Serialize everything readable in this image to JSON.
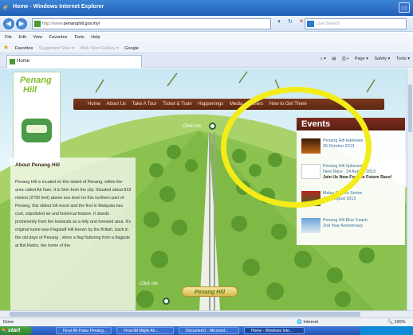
{
  "window": {
    "title": "Home - Windows Internet Explorer"
  },
  "address": {
    "url_prefix": "http://www.",
    "url_host": "penanghill.gov.my/",
    "search_placeholder": "Live Search"
  },
  "menu": [
    "File",
    "Edit",
    "View",
    "Favorites",
    "Tools",
    "Help"
  ],
  "favorites_bar": {
    "label": "Favorites",
    "items": [
      "Suggested Sites ▾",
      "Web Slice Gallery ▾",
      "Google"
    ]
  },
  "tab": {
    "label": "Home"
  },
  "command_bar": [
    "Page ▾",
    "Safety ▾",
    "Tools ▾"
  ],
  "site": {
    "logo_line1": "Penang",
    "logo_line2": "Hill",
    "nav": [
      "Home",
      "About Us",
      "Take A Tour",
      "Ticket & Train",
      "Happenings",
      "Media",
      "Others",
      "How to Get There"
    ],
    "click_me_top": "Click me",
    "click_me_bottom": "Click me",
    "banner": "Penang Hill",
    "about": {
      "title": "About Penang Hill",
      "body": "Penang Hill is located on this island of Penang, within the area called Air Itam. It is 5km from the city. Situated about 823 meters (2750 feet) above sea level on this northern part of Penang, this oldest hill resort and the first in Malaysia has cool, unpolluted air and historical feature. It stands prominently from the lowlands as a hilly and forested area. It's original name was Flagstaff Hill known by the British, back in the old days of Penang , when a flag fluttering from a flagpole at Bel Retiro, the home of the"
    },
    "events": {
      "heading": "Events",
      "items": [
        {
          "line1": "Penang Hill Hallowee",
          "line2": "26 October 2013",
          "line3": ""
        },
        {
          "line1": "Penang Hill Xplorace",
          "line2": "Next Race : 24 August 2013",
          "line3": "Join Us Now For The Future Race!"
        },
        {
          "line1": "Malay Culture Series",
          "line2": "17th August 2013",
          "line3": ""
        },
        {
          "line1": "Penang Hill Blue Coach",
          "line2": "2nd Year Anniversary",
          "line3": ""
        }
      ]
    }
  },
  "status": {
    "text": "Done",
    "zone": "Internet",
    "zoom": "100%"
  },
  "taskbar": {
    "start": "start",
    "tasks": [
      "Final-IM Pulau Penang...",
      "Final-IM Majlis Ah...",
      "Document1 - Microsof...",
      "Home - Windows Inte..."
    ]
  },
  "colors": {
    "accent_nav": "#5a2612",
    "highlight_ring": "#f4ec1a",
    "logo_green": "#7fbf2a"
  }
}
